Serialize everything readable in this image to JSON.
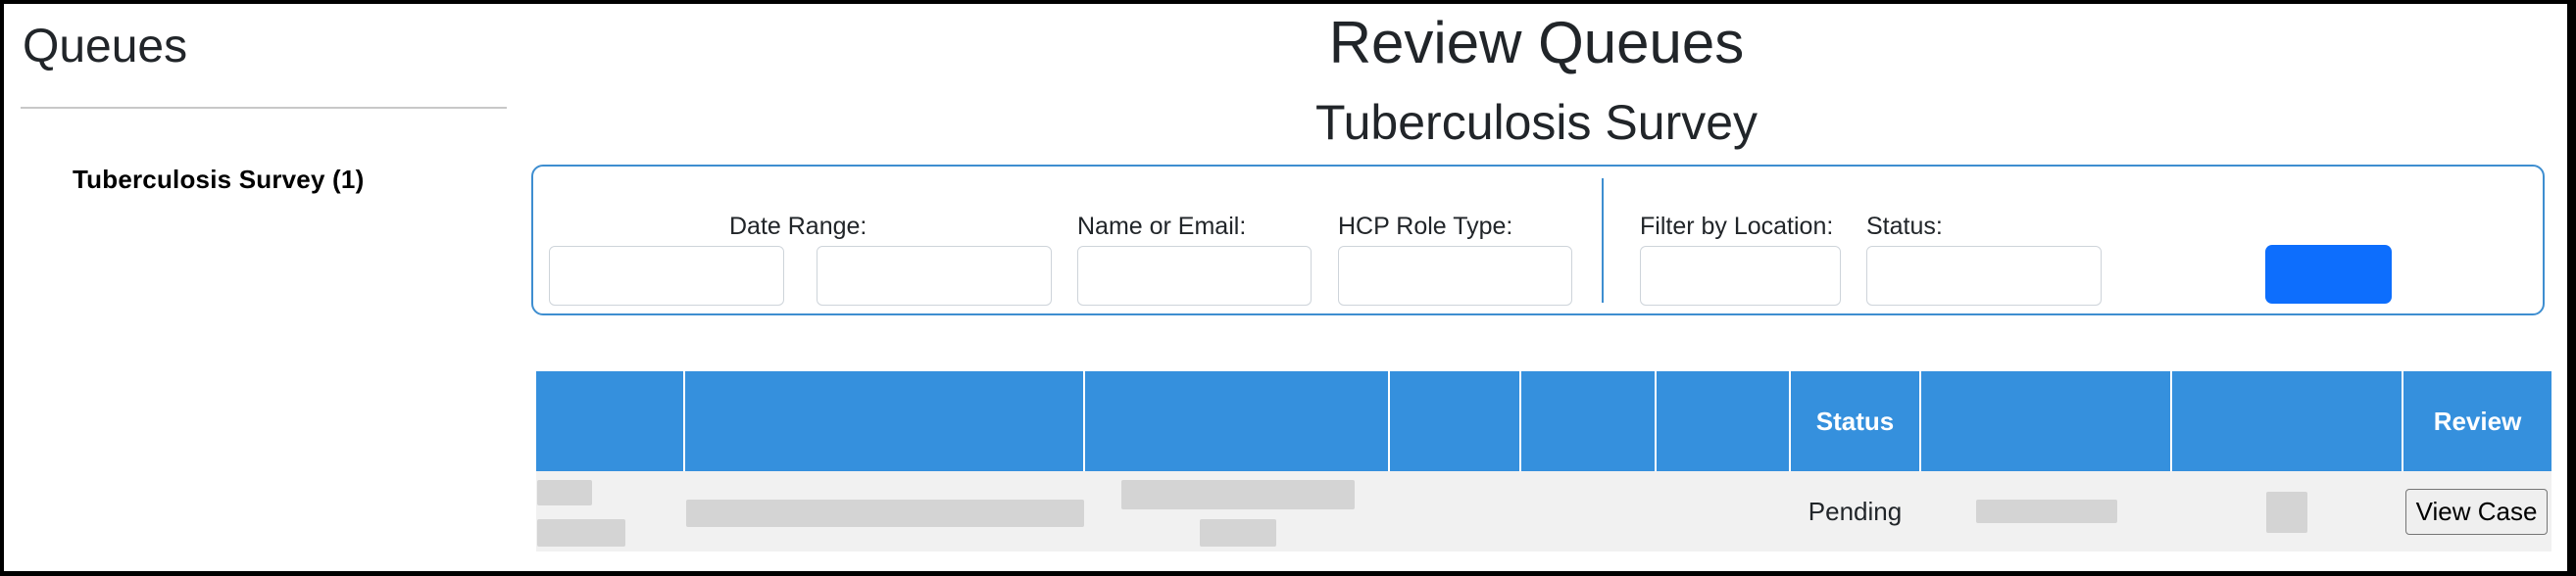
{
  "sidebar": {
    "title": "Queues",
    "items": [
      {
        "label": "Tuberculosis Survey (1)"
      }
    ]
  },
  "main": {
    "title": "Review Queues",
    "queue_title": "Tuberculosis Survey"
  },
  "filters": {
    "date_range_label": "Date Range:",
    "date_start": {
      "value": "",
      "placeholder": ""
    },
    "date_end": {
      "value": "",
      "placeholder": ""
    },
    "name_email_label": "Name or Email:",
    "name_email": {
      "value": "",
      "placeholder": ""
    },
    "hcp_role_label": "HCP Role Type:",
    "hcp_role": {
      "value": "",
      "placeholder": ""
    },
    "location_label": "Filter by Location:",
    "location": {
      "value": "",
      "placeholder": ""
    },
    "status_label": "Status:",
    "status": {
      "value": "",
      "placeholder": ""
    },
    "submit_label": ""
  },
  "table": {
    "columns": [
      "",
      "",
      "",
      "",
      "",
      "",
      "Status",
      "",
      "",
      "Review"
    ],
    "rows": [
      {
        "status": "Pending",
        "review_button": "View Case"
      }
    ]
  },
  "colors": {
    "header_blue": "#3590dd",
    "button_blue": "#0d6efd",
    "filter_border": "#3e8ed0",
    "row_bg": "#f1f1f1",
    "redacted": "#d4d4d4"
  }
}
